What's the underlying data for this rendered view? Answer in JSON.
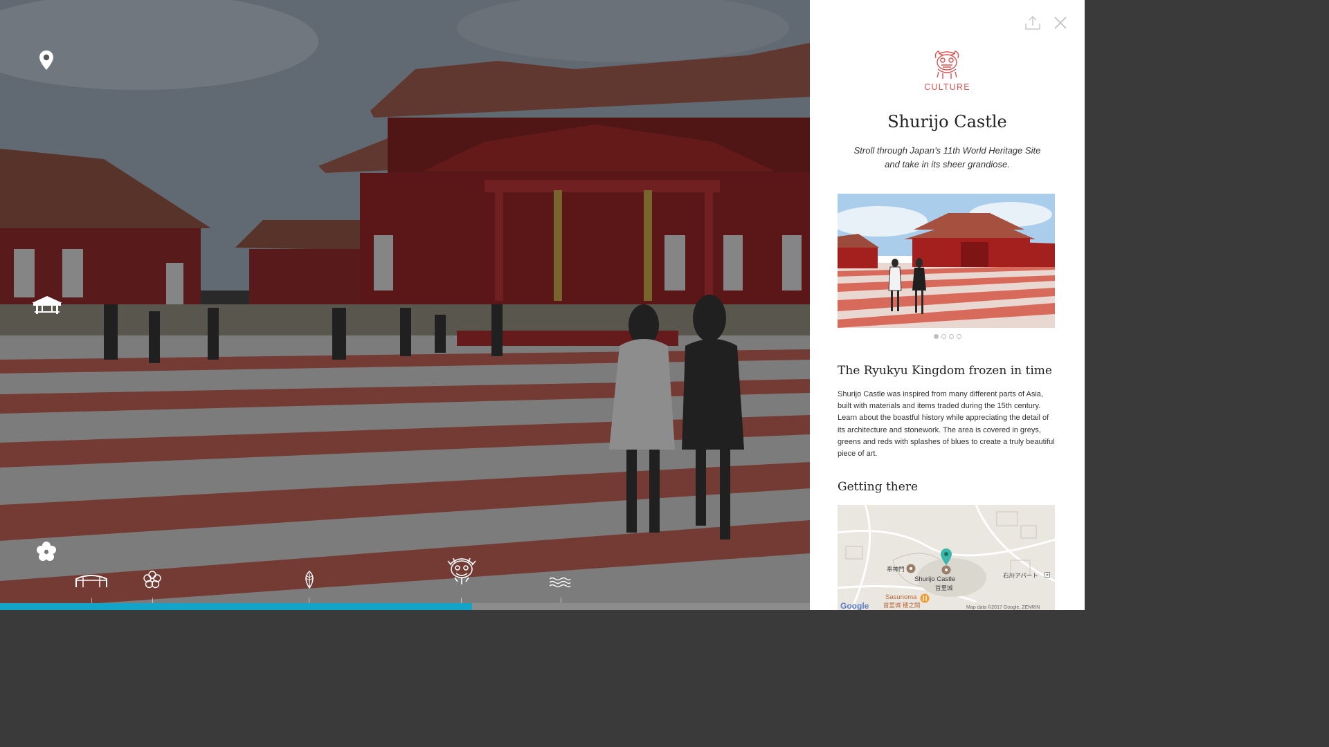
{
  "scene": {
    "pin_icon": "location-pin-icon",
    "pavilion_icon": "pavilion-icon",
    "flower_icon": "hibiscus-icon",
    "timeline": {
      "icons": [
        "bridge-icon",
        "flower-icon",
        "leaf-icon",
        "shisa-dragon-icon",
        "waves-icon"
      ],
      "progress": 0.583
    }
  },
  "panel": {
    "share_icon": "share-icon",
    "close_icon": "close-icon",
    "category": {
      "icon": "shisa-lion-icon",
      "label": "CULTURE",
      "color": "#e0504f"
    },
    "title": "Shurijo Castle",
    "subtitle": "Stroll through Japan’s 11th World Heritage Site and take in its sheer grandiose.",
    "gallery": {
      "count": 4,
      "active_index": 0
    },
    "section1": {
      "heading": "The Ryukyu Kingdom frozen in time",
      "body": "Shurijo Castle was inspired from many different parts of Asia, built with materials and items traded during the 15th century. Learn about the boastful history while appreciating the detail of its architecture and stonework. The area is covered in greys, greens and reds with splashes of blues to create a truly beautiful piece of art."
    },
    "section2": {
      "heading": "Getting there",
      "map": {
        "labels": {
          "gate": "奉神門",
          "castle_en": "Shurijo Castle",
          "castle_jp": "首里城",
          "apartment": "石川アパート",
          "restaurant_en": "Sasunoma",
          "restaurant_jp": "首里城 穂之間",
          "google": "Google",
          "attribution": "Map data ©2017 Google, ZENRIN"
        }
      }
    }
  },
  "colors": {
    "accent": "#13a5c9",
    "culture_red": "#e0504f"
  }
}
